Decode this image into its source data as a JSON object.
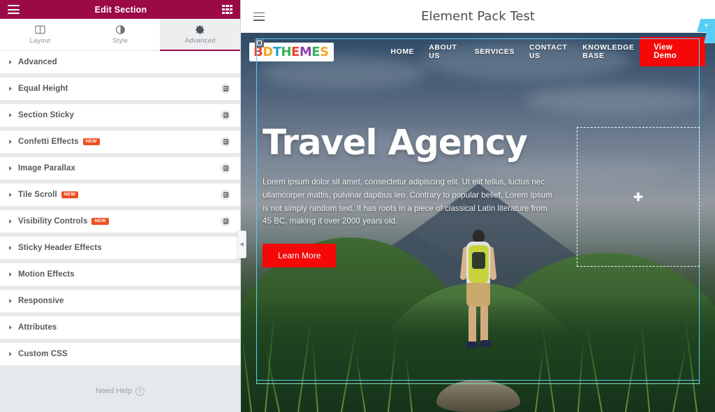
{
  "panel": {
    "header": {
      "title": "Edit Section",
      "menu_icon": "hamburger-icon",
      "apps_icon": "grid-icon"
    },
    "tabs": [
      {
        "label": "Layout",
        "icon": "columns-icon",
        "active": false
      },
      {
        "label": "Style",
        "icon": "contrast-icon",
        "active": false
      },
      {
        "label": "Advanced",
        "icon": "gear-icon",
        "active": true
      }
    ],
    "sections": [
      {
        "label": "Advanced",
        "badge": "",
        "pro": false
      },
      {
        "label": "Equal Height",
        "badge": "",
        "pro": true
      },
      {
        "label": "Section Sticky",
        "badge": "",
        "pro": true
      },
      {
        "label": "Confetti Effects",
        "badge": "NEW",
        "pro": true
      },
      {
        "label": "Image Parallax",
        "badge": "",
        "pro": true
      },
      {
        "label": "Tile Scroll",
        "badge": "NEW",
        "pro": true
      },
      {
        "label": "Visibility Controls",
        "badge": "NEW",
        "pro": true
      },
      {
        "label": "Sticky Header Effects",
        "badge": "",
        "pro": false
      },
      {
        "label": "Motion Effects",
        "badge": "",
        "pro": false
      },
      {
        "label": "Responsive",
        "badge": "",
        "pro": false
      },
      {
        "label": "Attributes",
        "badge": "",
        "pro": false
      },
      {
        "label": "Custom CSS",
        "badge": "",
        "pro": false
      }
    ],
    "footer": {
      "need_help": "Need Help",
      "help_icon": "question-mark-icon"
    },
    "collapse": {
      "icon": "chevron-left-icon"
    }
  },
  "preview": {
    "wp_bar": {
      "title": "Element Pack Test",
      "menu_icon": "hamburger-icon"
    },
    "site": {
      "logo": {
        "letters": [
          "B",
          "D",
          "T",
          "H",
          "E",
          "M",
          "E",
          "S"
        ],
        "badge_icon": "window-icon"
      },
      "nav": [
        "HOME",
        "ABOUT US",
        "SERVICES",
        "CONTACT US",
        "KNOWLEDGE BASE"
      ],
      "cta": "View Demo"
    },
    "hero": {
      "heading": "Travel Agency",
      "paragraph": "Lorem ipsum dolor sit amet, consectetur adipiscing elit. Ut elit tellus, luctus nec ullamcorper mattis, pulvinar dapibus leo.  Contrary to popular belief, Lorem Ipsum is not simply random text. It has roots in a piece of classical Latin literature from 45 BC, making it over 2000 years old.",
      "button": "Learn More",
      "empty_column_icon": "plus-icon"
    },
    "handles": {
      "outer": {
        "add_icon": "plus-icon",
        "edit_icon": "grid-icon",
        "close_icon": "close-icon"
      },
      "inner": {
        "edit_icon": "grid-icon",
        "close_icon": "close-icon"
      }
    }
  },
  "colors": {
    "panel_header": "#9b0a46",
    "accent_badge": "#f04f23",
    "cta_red": "#f40808",
    "elementor_blue": "#59cdf5"
  }
}
